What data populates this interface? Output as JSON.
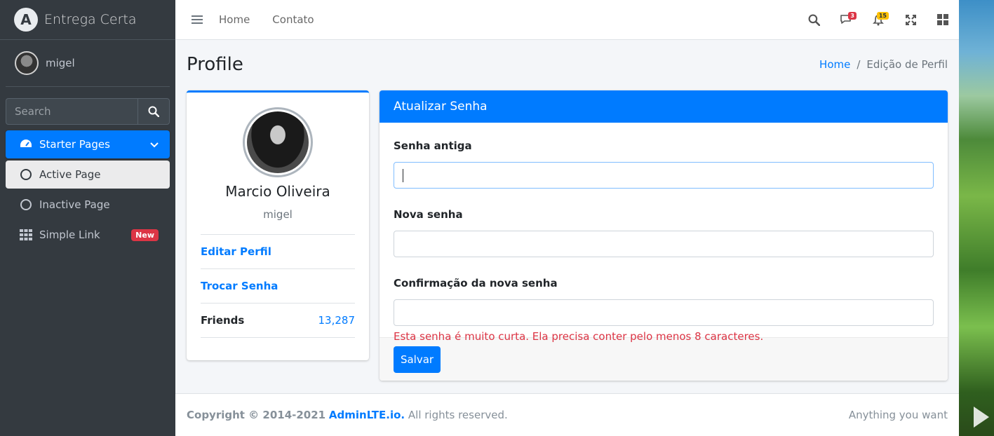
{
  "brand": {
    "name": "Entrega Certa",
    "logo_letter": "A"
  },
  "user": {
    "name": "migel"
  },
  "sidebar": {
    "search_placeholder": "Search",
    "items": [
      {
        "label": "Starter Pages",
        "icon": "tachometer-icon"
      },
      {
        "label": "Active Page",
        "icon": "circle-icon"
      },
      {
        "label": "Inactive Page",
        "icon": "circle-icon"
      },
      {
        "label": "Simple Link",
        "icon": "grid-icon",
        "badge": "New"
      }
    ]
  },
  "topnav": {
    "links": [
      "Home",
      "Contato"
    ],
    "messages_count": "3",
    "notifications_count": "15"
  },
  "header": {
    "title": "Profile",
    "breadcrumb": [
      "Home",
      "Edição de Perfil"
    ]
  },
  "profile": {
    "name": "Marcio Oliveira",
    "username": "migel",
    "edit_link": "Editar Perfil",
    "change_password_link": "Trocar Senha",
    "friends_label": "Friends",
    "friends_count": "13,287"
  },
  "password_form": {
    "title": "Atualizar Senha",
    "old_label": "Senha antiga",
    "new_label": "Nova senha",
    "confirm_label": "Confirmação da nova senha",
    "error": "Esta senha é muito curta. Ela precisa conter pelo menos 8 caracteres.",
    "submit": "Salvar"
  },
  "footer": {
    "copyright": "Copyright © 2014-2021",
    "brand_link": "AdminLTE.io.",
    "rights": "All rights reserved.",
    "right_text": "Anything you want"
  },
  "colors": {
    "primary": "#007bff",
    "sidebar": "#343a40",
    "danger": "#dc3545",
    "warning": "#ffc107"
  }
}
